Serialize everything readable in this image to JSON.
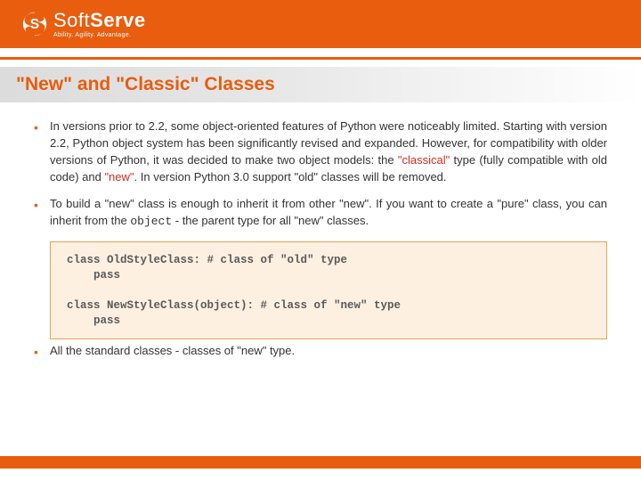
{
  "logo": {
    "name": "SoftServe",
    "soft": "Soft",
    "serve": "Serve",
    "tagline": "Ability. Agility. Advantage."
  },
  "title": "\"New\" and \"Classic\" Classes",
  "bullets": {
    "b1_a": "In versions prior to 2.2, some object-oriented features of Python were noticeably limited. Starting with version 2.2, Python object system has been significantly revised and expanded. However, for compatibility with older versions of Python, it was decided to make two object models: the ",
    "b1_classical": "\"classical\"",
    "b1_b": " type (fully compatible with old code) and ",
    "b1_new": "\"new\"",
    "b1_c": ".  In version Python 3.0 support \"old\" classes will be removed.",
    "b2_a": "To build a \"new\" class is enough to inherit it from other \"new\".  If you want to create a \"pure\" class, you can inherit from the ",
    "b2_obj": "object",
    "b2_b": " - the parent type for all \"new\" classes.",
    "b3": "All the standard classes - classes of \"new\" type."
  },
  "code": "class OldStyleClass: # class of \"old\" type\n    pass\n\nclass NewStyleClass(object): # class of \"new\" type\n    pass"
}
